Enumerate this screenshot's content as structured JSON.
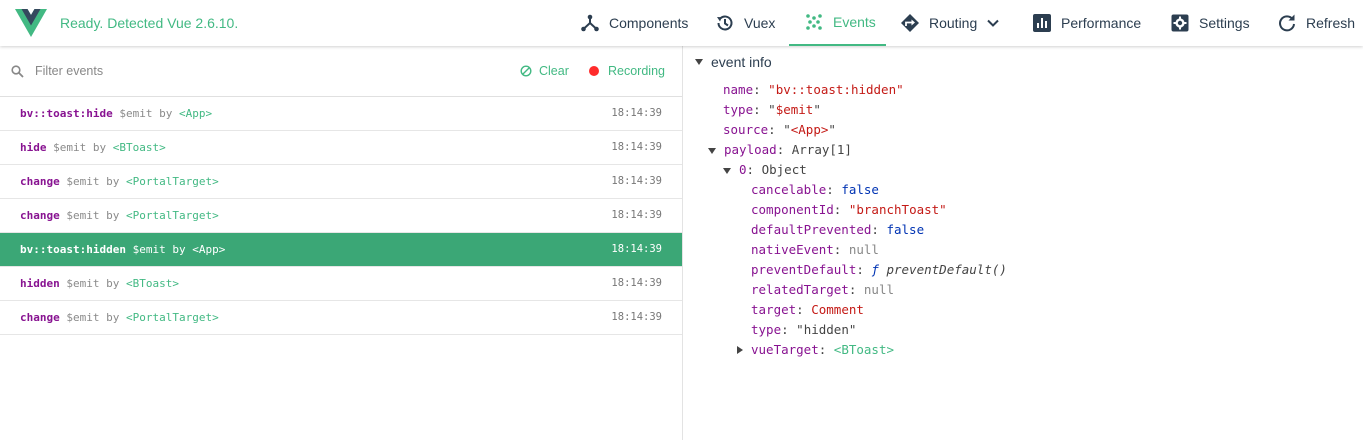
{
  "header": {
    "status": "Ready. Detected Vue 2.6.10.",
    "nav": [
      {
        "label": "Components",
        "icon": "components-icon"
      },
      {
        "label": "Vuex",
        "icon": "history-icon"
      },
      {
        "label": "Events",
        "icon": "events-icon",
        "active": true
      },
      {
        "label": "Routing",
        "icon": "routing-icon"
      },
      {
        "label": "Performance",
        "icon": "performance-icon"
      },
      {
        "label": "Settings",
        "icon": "settings-icon"
      },
      {
        "label": "Refresh",
        "icon": "refresh-icon"
      }
    ]
  },
  "filter": {
    "placeholder": "Filter events",
    "clear_label": "Clear",
    "recording_label": "Recording"
  },
  "events": [
    {
      "name": "bv::toast:hide",
      "type": "$emit",
      "by": "by",
      "source": "<App>",
      "time": "18:14:39"
    },
    {
      "name": "hide",
      "type": "$emit",
      "by": "by",
      "source": "<BToast>",
      "time": "18:14:39"
    },
    {
      "name": "change",
      "type": "$emit",
      "by": "by",
      "source": "<PortalTarget>",
      "time": "18:14:39"
    },
    {
      "name": "change",
      "type": "$emit",
      "by": "by",
      "source": "<PortalTarget>",
      "time": "18:14:39"
    },
    {
      "name": "bv::toast:hidden",
      "type": "$emit",
      "by": "by",
      "source": "<App>",
      "time": "18:14:39",
      "selected": true
    },
    {
      "name": "hidden",
      "type": "$emit",
      "by": "by",
      "source": "<BToast>",
      "time": "18:14:39"
    },
    {
      "name": "change",
      "type": "$emit",
      "by": "by",
      "source": "<PortalTarget>",
      "time": "18:14:39"
    }
  ],
  "details": {
    "title": "event info",
    "name_key": "name",
    "name_val": "\"bv::toast:hidden\"",
    "type_key": "type",
    "type_val_q1": "\"",
    "type_val": "$emit",
    "type_val_q2": "\"",
    "source_key": "source",
    "source_q1": "\"",
    "source_val": "<App>",
    "source_q2": "\"",
    "payload_key": "payload",
    "payload_val": "Array[1]",
    "item_key": "0",
    "item_val": "Object",
    "props": {
      "cancelable_k": "cancelable",
      "cancelable_v": "false",
      "componentId_k": "componentId",
      "componentId_v": "\"branchToast\"",
      "defaultPrevented_k": "defaultPrevented",
      "defaultPrevented_v": "false",
      "nativeEvent_k": "nativeEvent",
      "nativeEvent_v": "null",
      "preventDefault_k": "preventDefault",
      "preventDefault_f": "ƒ",
      "preventDefault_v": "preventDefault()",
      "relatedTarget_k": "relatedTarget",
      "relatedTarget_v": "null",
      "target_k": "target",
      "target_v": "Comment",
      "type_k": "type",
      "type_v": "\"hidden\"",
      "vueTarget_k": "vueTarget",
      "vueTarget_v": "<BToast>"
    }
  }
}
